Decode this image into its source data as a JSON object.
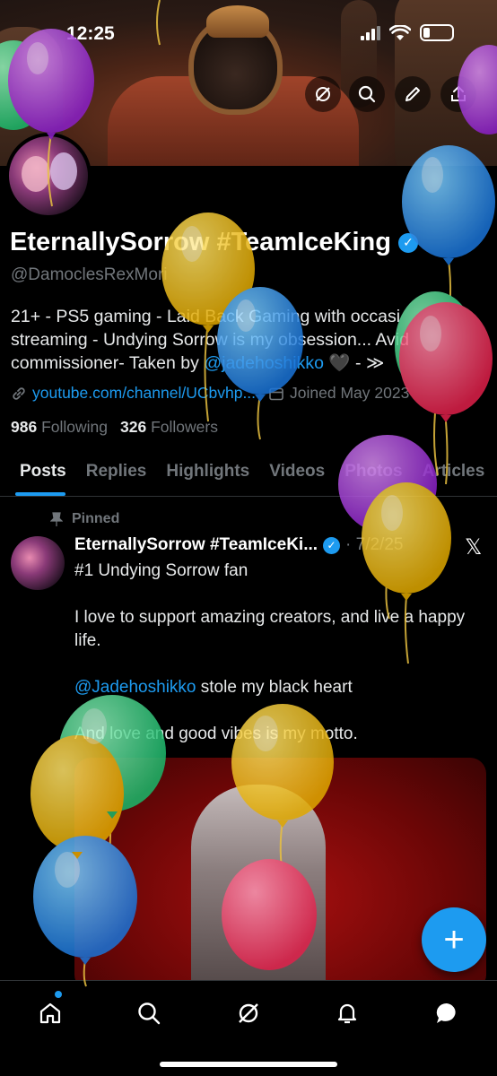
{
  "status_bar": {
    "time": "12:25"
  },
  "profile": {
    "display_name": "EternallySorrow #TeamIceKing",
    "handle": "@DamoclesRexMori",
    "bio_lines": [
      "21+ - PS5 gaming - Laid Back Gaming with occasi",
      "streaming - Undying Sorrow is my obsession... Avid",
      "commissioner- Taken by "
    ],
    "bio_mention": "@jadehoshikko",
    "bio_tail": " 🖤 - ≫",
    "website": "youtube.com/channel/UCbvhp...",
    "joined": "Joined May 2023",
    "following_count": "986",
    "following_label": "Following",
    "followers_count": "326",
    "followers_label": "Followers"
  },
  "tabs": [
    "Posts",
    "Replies",
    "Highlights",
    "Videos",
    "Photos",
    "Articles"
  ],
  "post": {
    "pinned_label": "Pinned",
    "author": "EternallySorrow #TeamIceKi...",
    "date": "· 7/2/25",
    "line1": "#1 Undying Sorrow fan",
    "line2": "I love to support amazing creators, and live a happy life.",
    "mention": "@Jadehoshikko",
    "line3_rest": " stole my black heart",
    "line4": "And love and good vibes is my motto."
  },
  "fab_label": "+",
  "colors": {
    "accent": "#1d9bf0",
    "background": "#000000",
    "muted": "#71767b"
  },
  "icons": [
    "grok-icon",
    "search-icon",
    "edit-icon",
    "share-icon",
    "home-icon",
    "explore-icon",
    "grok-nav-icon",
    "notifications-icon",
    "messages-icon",
    "pin-icon",
    "link-icon",
    "calendar-icon",
    "x-logo-icon"
  ]
}
